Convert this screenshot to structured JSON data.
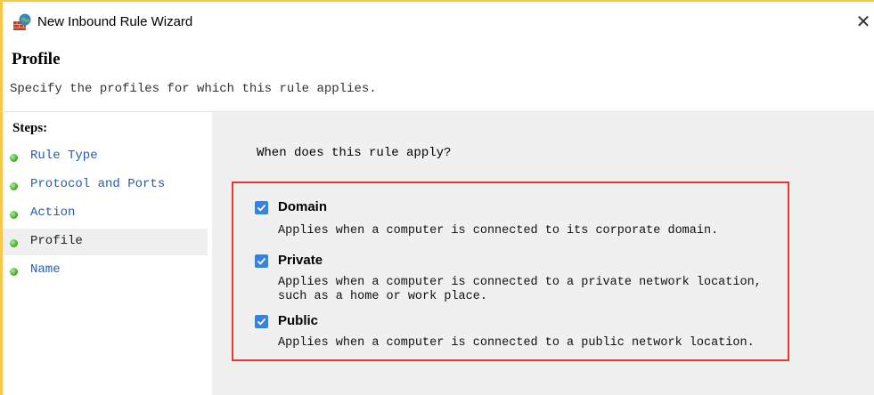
{
  "window": {
    "title": "New Inbound Rule Wizard",
    "close_symbol": "✕",
    "app_icon": "firewall-icon"
  },
  "header": {
    "title": "Profile",
    "subtitle": "Specify the profiles for which this rule applies."
  },
  "steps": {
    "header": "Steps:",
    "items": [
      {
        "label": "Rule Type",
        "current": false
      },
      {
        "label": "Protocol and Ports",
        "current": false
      },
      {
        "label": "Action",
        "current": false
      },
      {
        "label": "Profile",
        "current": true
      },
      {
        "label": "Name",
        "current": false
      }
    ]
  },
  "content": {
    "question": "When does this rule apply?",
    "options": [
      {
        "label": "Domain",
        "checked": true,
        "description": "Applies when a computer is connected to its corporate domain."
      },
      {
        "label": "Private",
        "checked": true,
        "description": "Applies when a computer is connected to a private network location,\nsuch as a home or work place."
      },
      {
        "label": "Public",
        "checked": true,
        "description": "Applies when a computer is connected to a public network location."
      }
    ]
  },
  "colors": {
    "accent_checkbox": "#3c82d8",
    "highlight_border": "#e53935",
    "step_link": "#1f5fb0",
    "window_border": "#f5c84c"
  }
}
